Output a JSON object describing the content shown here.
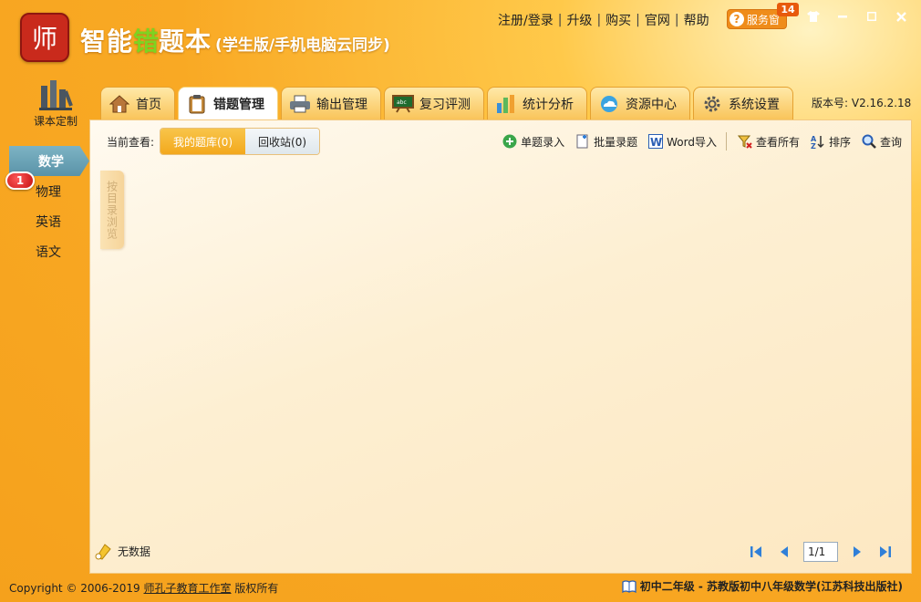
{
  "app": {
    "logo_text": "师",
    "title_part1": "智能",
    "title_part2": "错",
    "title_part3": "题本",
    "title_suffix": "(学生版/手机电脑云同步)"
  },
  "top_links": [
    "注册/登录",
    "升级",
    "购买",
    "官网",
    "帮助"
  ],
  "service": {
    "label": "服务窗",
    "badge": "14"
  },
  "window_buttons": [
    "shirt-icon",
    "minimize-icon",
    "maximize-icon",
    "close-icon"
  ],
  "course_custom": {
    "label": "课本定制"
  },
  "subjects": {
    "items": [
      "数学",
      "物理",
      "英语",
      "语文"
    ],
    "active": "数学",
    "badge": "1"
  },
  "tabs": [
    {
      "label": "首页",
      "icon": "home-icon"
    },
    {
      "label": "错题管理",
      "icon": "clipboard-icon"
    },
    {
      "label": "输出管理",
      "icon": "printer-icon"
    },
    {
      "label": "复习评测",
      "icon": "blackboard-icon"
    },
    {
      "label": "统计分析",
      "icon": "bar-chart-icon"
    },
    {
      "label": "资源中心",
      "icon": "cloud-icon"
    },
    {
      "label": "系统设置",
      "icon": "gear-icon"
    }
  ],
  "active_tab": "错题管理",
  "version": "版本号: V2.16.2.18",
  "toolbar": {
    "view_label": "当前查看:",
    "my_bank": "我的题库(0)",
    "recycle": "回收站(0)",
    "single_entry": "单题录入",
    "batch_entry": "批量录题",
    "word_import": "Word导入",
    "view_all": "查看所有",
    "sort": "排序",
    "search": "查询"
  },
  "dir_tab": "按目录浏览",
  "status": {
    "no_data": "无数据"
  },
  "pager": {
    "page": "1/1"
  },
  "footer": {
    "copyright_prefix": "Copyright © 2006-2019",
    "studio": "师孔子教育工作室",
    "rights": "版权所有",
    "grade": "初中二年级 - 苏教版初中八年级数学(江苏科技出版社)"
  },
  "colors": {
    "accent_orange": "#f5a11c",
    "active_subject": "#5a93a8",
    "green_title": "#7ed321",
    "pager_blue": "#2f7fd8"
  }
}
